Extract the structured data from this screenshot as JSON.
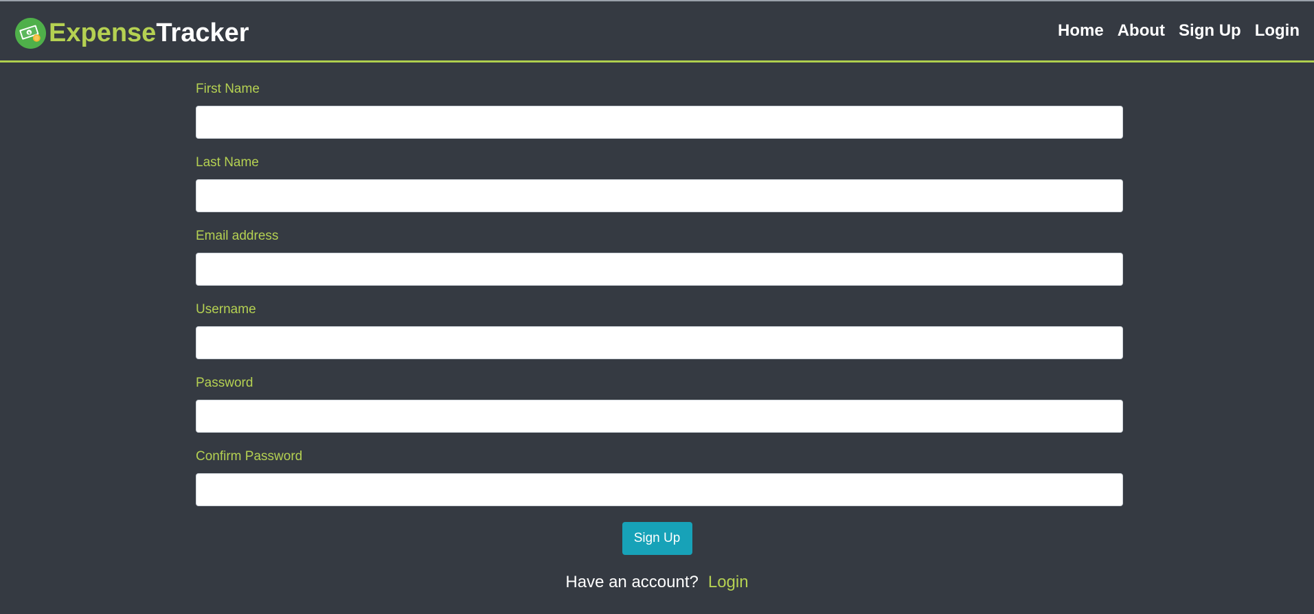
{
  "brand": {
    "name_part1": "Expense",
    "name_part2": "Tracker",
    "logo_icon": "money-coin-icon"
  },
  "nav": {
    "links": [
      "Home",
      "About",
      "Sign Up",
      "Login"
    ]
  },
  "form": {
    "fields": [
      {
        "label": "First Name",
        "value": "",
        "type": "text"
      },
      {
        "label": "Last Name",
        "value": "",
        "type": "text"
      },
      {
        "label": "Email address",
        "value": "",
        "type": "email"
      },
      {
        "label": "Username",
        "value": "",
        "type": "text"
      },
      {
        "label": "Password",
        "value": "",
        "type": "password"
      },
      {
        "label": "Confirm Password",
        "value": "",
        "type": "password"
      }
    ],
    "submit_label": "Sign Up"
  },
  "footer": {
    "prompt": "Have an account?",
    "link_label": "Login"
  },
  "colors": {
    "background": "#353a42",
    "accent": "#b5d152",
    "button": "#17a2b8",
    "text": "#ffffff"
  }
}
